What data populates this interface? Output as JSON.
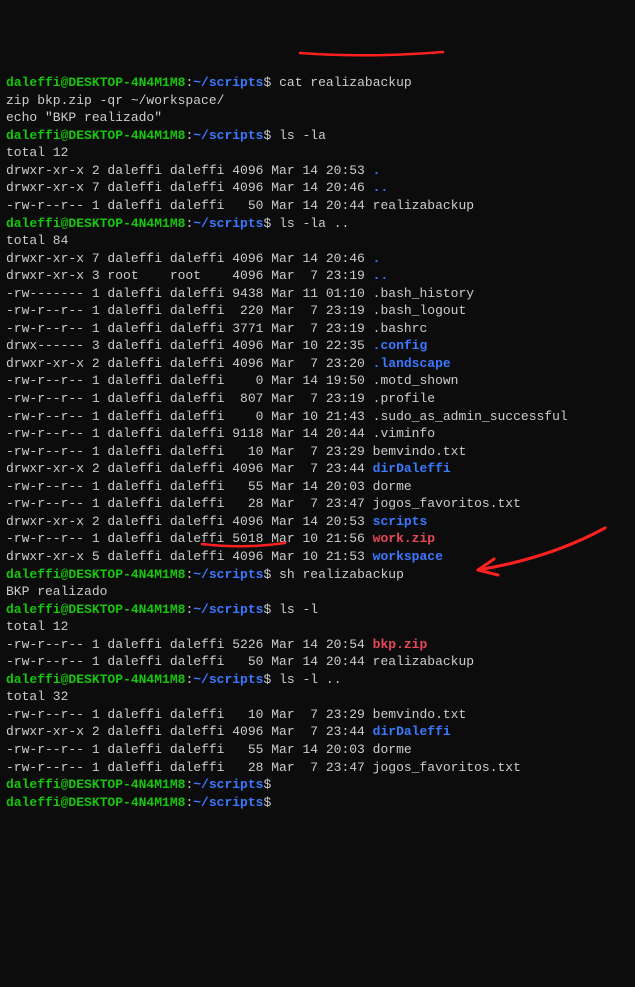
{
  "prompt": {
    "user": "daleffi@DESKTOP-4N4M1M8",
    "path": "~/scripts",
    "sep": ":",
    "dollar": "$"
  },
  "cmds": {
    "cat": "cat realizabackup",
    "lsla": "ls -la",
    "lslaup": "ls -la ..",
    "sh": "sh realizabackup",
    "lsl": "ls -l",
    "lslup": "ls -l ..",
    "blank": ""
  },
  "scriptContent": {
    "l1": "zip bkp.zip -qr ~/workspace/",
    "l2": "echo \"BKP realizado\""
  },
  "lsla_out": {
    "total": "total 12",
    "r0": "drwxr-xr-x 2 daleffi daleffi 4096 Mar 14 20:53 ",
    "r0d": ".",
    "r1": "drwxr-xr-x 7 daleffi daleffi 4096 Mar 14 20:46 ",
    "r1d": "..",
    "r2": "-rw-r--r-- 1 daleffi daleffi   50 Mar 14 20:44 realizabackup"
  },
  "lslaup_out": {
    "total": "total 84",
    "rows": [
      {
        "p": "drwxr-xr-x 7 daleffi daleffi 4096 Mar 14 20:46 ",
        "n": ".",
        "c": "dir"
      },
      {
        "p": "drwxr-xr-x 3 root    root    4096 Mar  7 23:19 ",
        "n": "..",
        "c": "dir"
      },
      {
        "p": "-rw------- 1 daleffi daleffi 9438 Mar 11 01:10 ",
        "n": ".bash_history",
        "c": "file"
      },
      {
        "p": "-rw-r--r-- 1 daleffi daleffi  220 Mar  7 23:19 ",
        "n": ".bash_logout",
        "c": "file"
      },
      {
        "p": "-rw-r--r-- 1 daleffi daleffi 3771 Mar  7 23:19 ",
        "n": ".bashrc",
        "c": "file"
      },
      {
        "p": "drwx------ 3 daleffi daleffi 4096 Mar 10 22:35 ",
        "n": ".config",
        "c": "dir"
      },
      {
        "p": "drwxr-xr-x 2 daleffi daleffi 4096 Mar  7 23:20 ",
        "n": ".landscape",
        "c": "dir"
      },
      {
        "p": "-rw-r--r-- 1 daleffi daleffi    0 Mar 14 19:50 ",
        "n": ".motd_shown",
        "c": "file"
      },
      {
        "p": "-rw-r--r-- 1 daleffi daleffi  807 Mar  7 23:19 ",
        "n": ".profile",
        "c": "file"
      },
      {
        "p": "-rw-r--r-- 1 daleffi daleffi    0 Mar 10 21:43 ",
        "n": ".sudo_as_admin_successful",
        "c": "file"
      },
      {
        "p": "-rw-r--r-- 1 daleffi daleffi 9118 Mar 14 20:44 ",
        "n": ".viminfo",
        "c": "file"
      },
      {
        "p": "-rw-r--r-- 1 daleffi daleffi   10 Mar  7 23:29 ",
        "n": "bemvindo.txt",
        "c": "file"
      },
      {
        "p": "drwxr-xr-x 2 daleffi daleffi 4096 Mar  7 23:44 ",
        "n": "dirDaleffi",
        "c": "dir"
      },
      {
        "p": "-rw-r--r-- 1 daleffi daleffi   55 Mar 14 20:03 ",
        "n": "dorme",
        "c": "file"
      },
      {
        "p": "-rw-r--r-- 1 daleffi daleffi   28 Mar  7 23:47 ",
        "n": "jogos_favoritos.txt",
        "c": "file"
      },
      {
        "p": "drwxr-xr-x 2 daleffi daleffi 4096 Mar 14 20:53 ",
        "n": "scripts",
        "c": "dir"
      },
      {
        "p": "-rw-r--r-- 1 daleffi daleffi 5018 Mar 10 21:56 ",
        "n": "work.zip",
        "c": "zip"
      },
      {
        "p": "drwxr-xr-x 5 daleffi daleffi 4096 Mar 10 21:53 ",
        "n": "workspace",
        "c": "dir"
      }
    ]
  },
  "sh_out": {
    "l1": "BKP realizado"
  },
  "lsl_out": {
    "total": "total 12",
    "rows": [
      {
        "p": "-rw-r--r-- 1 daleffi daleffi 5226 Mar 14 20:54 ",
        "n": "bkp.zip",
        "c": "zip"
      },
      {
        "p": "-rw-r--r-- 1 daleffi daleffi   50 Mar 14 20:44 ",
        "n": "realizabackup",
        "c": "file"
      }
    ]
  },
  "lslup_out": {
    "total": "total 32",
    "rows": [
      {
        "p": "-rw-r--r-- 1 daleffi daleffi   10 Mar  7 23:29 ",
        "n": "bemvindo.txt",
        "c": "file"
      },
      {
        "p": "drwxr-xr-x 2 daleffi daleffi 4096 Mar  7 23:44 ",
        "n": "dirDaleffi",
        "c": "dir"
      },
      {
        "p": "-rw-r--r-- 1 daleffi daleffi   55 Mar 14 20:03 ",
        "n": "dorme",
        "c": "file"
      },
      {
        "p": "-rw-r--r-- 1 daleffi daleffi   28 Mar  7 23:47 ",
        "n": "jogos_favoritos.txt",
        "c": "file"
      }
    ]
  }
}
